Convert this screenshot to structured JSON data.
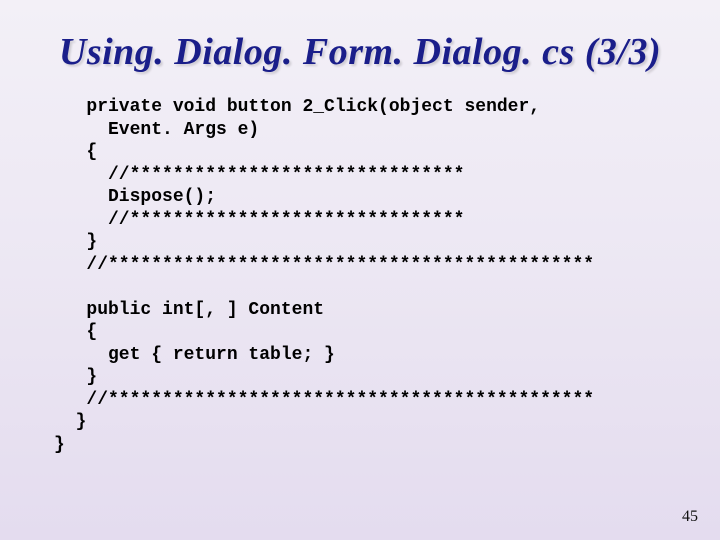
{
  "title": "Using. Dialog. Form. Dialog. cs (3/3)",
  "code_lines": [
    "   private void button 2_Click(object sender,",
    "     Event. Args e)",
    "   {",
    "     //*******************************",
    "     Dispose();",
    "     //*******************************",
    "   }",
    "   //*********************************************",
    "",
    "   public int[, ] Content",
    "   {",
    "     get { return table; }",
    "   }",
    "   //*********************************************",
    "  }",
    "}"
  ],
  "page_number": "45"
}
